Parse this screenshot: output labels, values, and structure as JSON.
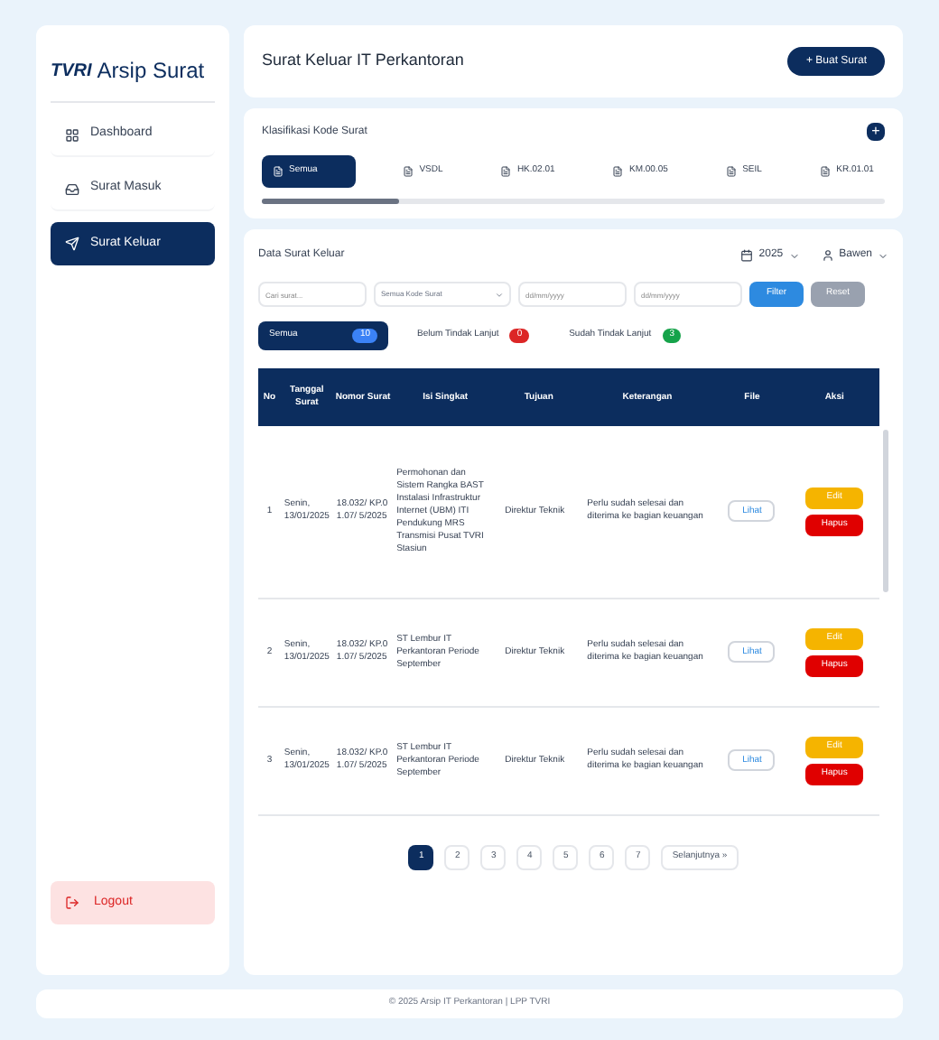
{
  "logo": {
    "mark": "TVRI",
    "title": "Arsip Surat"
  },
  "sidebar": {
    "items": [
      {
        "label": "Dashboard",
        "selected": false
      },
      {
        "label": "Surat Masuk",
        "selected": false
      },
      {
        "label": "Surat Keluar",
        "selected": true
      }
    ],
    "logout": "Logout"
  },
  "header": {
    "title": "Surat Keluar IT Perkantoran",
    "button": "+ Buat Surat"
  },
  "classification": {
    "title": "Klasifikasi Kode Surat",
    "add": "+",
    "tabs": [
      {
        "label": "Semua",
        "selected": true
      },
      {
        "label": "VSDL",
        "selected": false
      },
      {
        "label": "HK.02.01",
        "selected": false
      },
      {
        "label": "KM.00.05",
        "selected": false
      },
      {
        "label": "SEIL",
        "selected": false
      },
      {
        "label": "KR.01.01",
        "selected": false
      }
    ]
  },
  "data": {
    "title": "Data Surat Keluar",
    "year": "2025",
    "owner": "Bawen",
    "filters": {
      "search": {
        "placeholder": "Cari surat..."
      },
      "code": "Semua Kode Surat",
      "from": {
        "placeholder": "dd/mm/yyyy"
      },
      "to": {
        "placeholder": "dd/mm/yyyy"
      },
      "apply": "Filter",
      "reset": "Reset"
    },
    "status": [
      {
        "label": "Semua",
        "count": "10",
        "color": "#3b82f6",
        "selected": true
      },
      {
        "label": "Belum Tindak Lanjut",
        "count": "0",
        "color": "#dc2626",
        "selected": false
      },
      {
        "label": "Sudah Tindak Lanjut",
        "count": "3",
        "color": "#16a34a",
        "selected": false
      }
    ],
    "columns": [
      "No",
      "Tanggal Surat",
      "Nomor Surat",
      "Isi Singkat",
      "Tujuan",
      "Keterangan",
      "File",
      "Aksi"
    ],
    "rows": [
      {
        "no": "1",
        "date": "Senin, 13/01/2025",
        "number": "18.032/ KP.01.07/ 5/2025",
        "content": "Permohonan dan Sistem Rangka BAST Instalasi Infrastruktur Internet (UBM) ITI Pendukung MRS Transmisi Pusat TVRI Stasiun",
        "to": "Direktur Teknik",
        "note": "Perlu sudah selesai dan diterima ke bagian keuangan",
        "file": "Lihat",
        "edit": "Edit",
        "delete": "Hapus"
      },
      {
        "no": "2",
        "date": "Senin, 13/01/2025",
        "number": "18.032/ KP.01.07/ 5/2025",
        "content": "ST Lembur IT Perkantoran Periode September",
        "to": "Direktur Teknik",
        "note": "Perlu sudah selesai dan diterima ke bagian keuangan",
        "file": "Lihat",
        "edit": "Edit",
        "delete": "Hapus"
      },
      {
        "no": "3",
        "date": "Senin, 13/01/2025",
        "number": "18.032/ KP.01.07/ 5/2025",
        "content": "ST Lembur IT Perkantoran Periode September",
        "to": "Direktur Teknik",
        "note": "Perlu sudah selesai dan diterima ke bagian keuangan",
        "file": "Lihat",
        "edit": "Edit",
        "delete": "Hapus"
      }
    ],
    "pages": [
      {
        "label": "1",
        "selected": true
      },
      {
        "label": "2",
        "selected": false
      },
      {
        "label": "3",
        "selected": false
      },
      {
        "label": "4",
        "selected": false
      },
      {
        "label": "5",
        "selected": false
      },
      {
        "label": "6",
        "selected": false
      },
      {
        "label": "7",
        "selected": false
      }
    ],
    "next": "Selanjutnya »"
  },
  "footer": "© 2025 Arsip IT Perkantoran | LPP TVRI"
}
